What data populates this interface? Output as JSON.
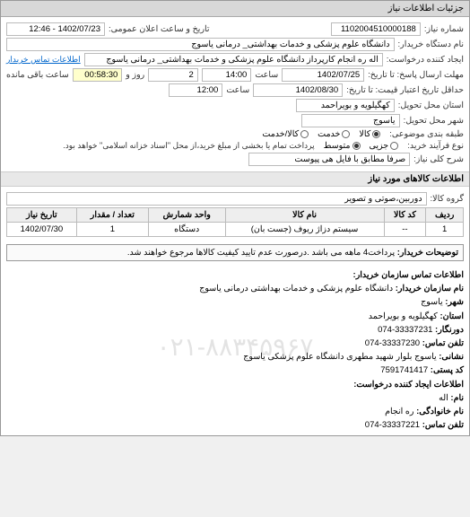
{
  "header": {
    "title": "جزئیات اطلاعات نیاز"
  },
  "main": {
    "need_number_label": "شماره نیاز:",
    "need_number": "1102004510000188",
    "announce_label": "تاریخ و ساعت اعلان عمومی:",
    "announce_value": "1402/07/23 - 12:46",
    "buyer_org_label": "نام دستگاه خریدار:",
    "buyer_org": "دانشگاه علوم پزشکی و خدمات بهداشتی_ درمانی یاسوج",
    "requester_label": "ایجاد کننده درخواست:",
    "requester": "اله ره انجام کارپرداز دانشگاه علوم پزشکی و خدمات بهداشتی_ درمانی یاسوج",
    "contact_link": "اطلاعات تماس خریدار",
    "deadline_send_label": "مهلت ارسال پاسخ: تا تاریخ:",
    "deadline_send_date": "1402/07/25",
    "time_label": "ساعت",
    "deadline_send_time": "14:00",
    "days_label": "روز و",
    "days_value": "2",
    "remain_time": "00:58:30",
    "remain_label": "ساعت باقی مانده",
    "validity_label": "حداقل تاریخ اعتبار قیمت: تا تاریخ:",
    "validity_date": "1402/08/30",
    "validity_time": "12:00",
    "province_label": "استان محل تحویل:",
    "province": "کهگیلویه و بویراحمد",
    "city_label": "شهر محل تحویل:",
    "city": "یاسوج",
    "class_label": "طبقه بندی موضوعی:",
    "class_goods": "کالا",
    "class_service": "خدمت",
    "class_both": "کالا/خدمت",
    "buy_type_label": "نوع فرآیند خرید:",
    "buy_small": "جزیی",
    "buy_medium": "متوسط",
    "buy_note": "پرداخت تمام یا بخشی از مبلغ خرید،از محل \"اسناد خزانه اسلامی\" خواهد بود.",
    "desc_label": "شرح کلی نیاز:",
    "desc_value": "صرفا مطابق با فایل هی پیوست"
  },
  "goods_section": {
    "title": "اطلاعات کالاهای مورد نیاز",
    "group_label": "گروه کالا:",
    "group_value": "دوربین،صوتی و تصویر",
    "cols": {
      "row": "ردیف",
      "code": "کد کالا",
      "name": "نام کالا",
      "unit": "واحد شمارش",
      "qty": "تعداد / مقدار",
      "date": "تاریخ نیاز"
    },
    "rows": [
      {
        "idx": "1",
        "code": "--",
        "name": "سیستم دزاژ ریوف (جست بان)",
        "unit": "دستگاه",
        "qty": "1",
        "date": "1402/07/30"
      }
    ],
    "buyer_note_label": "توضیحات خریدار:",
    "buyer_note": "پرداخت4 ماهه می باشد .درصورت عدم تایید کیفیت کالاها مرجوع خواهند شد."
  },
  "watermark": "۰۲۱-۸۸۳۴۵۹۶۷",
  "contact": {
    "title": "اطلاعات تماس سازمان خریدار:",
    "org_label": "نام سازمان خریدار:",
    "org": "دانشگاه علوم پزشکی و خدمات بهداشتی درمانی یاسوج",
    "city_label": "شهر:",
    "city": "یاسوج",
    "province_label": "استان:",
    "province": "کهگیلویه و بویراحمد",
    "faxes_label": "دورنگار:",
    "faxes": "33337231-074",
    "phone_label": "تلفن تماس:",
    "phone": "33337230-074",
    "address_label": "نشانی:",
    "address": "یاسوج بلوار شهید مطهری دانشگاه علوم پزشکی یاسوج",
    "postal_label": "کد پستی:",
    "postal": "7591741417",
    "creator_title": "اطلاعات ایجاد کننده درخواست:",
    "name_label": "نام:",
    "name": "اله",
    "family_label": "نام خانوادگی:",
    "family": "ره انجام",
    "tel_label": "تلفن تماس:",
    "tel": "33337221-074"
  }
}
